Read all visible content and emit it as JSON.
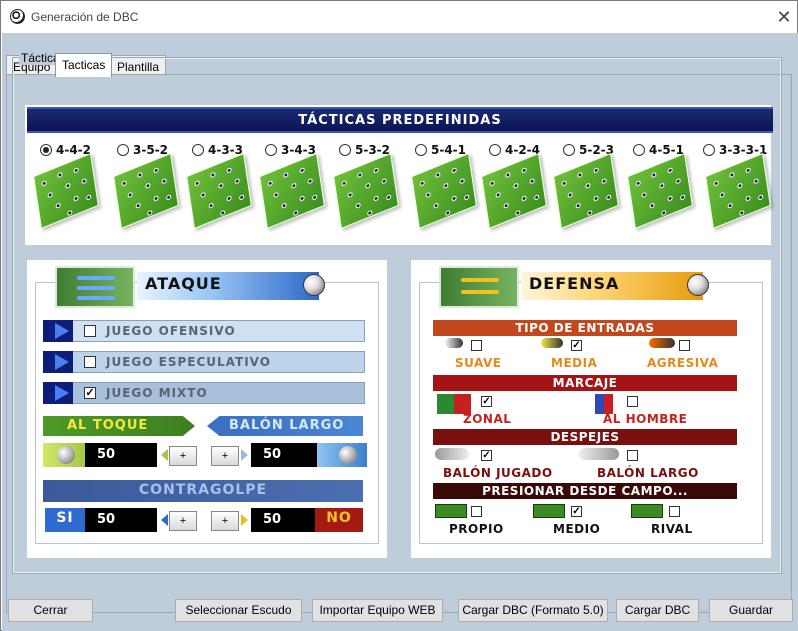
{
  "window": {
    "title": "Generación de DBC",
    "close_glyph": "✕"
  },
  "tabs": [
    {
      "label": "Equipo"
    },
    {
      "label": "Tacticas"
    },
    {
      "label": "Plantilla"
    }
  ],
  "group": {
    "label": "Táctica"
  },
  "predefinidas": {
    "title": "TÁCTICAS PREDEFINIDAS",
    "selected": "4-4-2",
    "formations": [
      "4-4-2",
      "3-5-2",
      "4-3-3",
      "3-4-3",
      "5-3-2",
      "5-4-1",
      "4-2-4",
      "5-2-3",
      "4-5-1",
      "3-3-3-1"
    ]
  },
  "ataque": {
    "title": "ATAQUE",
    "options": [
      {
        "label": "JUEGO OFENSIVO",
        "checked": false
      },
      {
        "label": "JUEGO ESPECULATIVO",
        "checked": false
      },
      {
        "label": "JUEGO MIXTO",
        "checked": true
      }
    ],
    "al_toque": "AL TOQUE",
    "balon_largo": "BALÓN LARGO",
    "al_toque_value": "50",
    "balon_largo_value": "50",
    "contragolpe": "CONTRAGOLPE",
    "si": "SI",
    "no": "NO",
    "si_value": "50",
    "no_value": "50",
    "plus": "+"
  },
  "defensa": {
    "title": "DEFENSA",
    "tipo_entradas": "TIPO DE ENTRADAS",
    "entradas": [
      {
        "label": "SUAVE",
        "checked": false
      },
      {
        "label": "MEDIA",
        "checked": true
      },
      {
        "label": "AGRESIVA",
        "checked": false
      }
    ],
    "marcaje": "MARCAJE",
    "marcajes": [
      {
        "label": "ZONAL",
        "checked": true
      },
      {
        "label": "AL HOMBRE",
        "checked": false
      }
    ],
    "despejes": "DESPEJES",
    "despeje_opts": [
      {
        "label": "BALÓN JUGADO",
        "checked": true
      },
      {
        "label": "BALÓN LARGO",
        "checked": false
      }
    ],
    "presionar": "PRESIONAR DESDE CAMPO...",
    "presion_opts": [
      {
        "label": "PROPIO",
        "checked": false
      },
      {
        "label": "MEDIO",
        "checked": true
      },
      {
        "label": "RIVAL",
        "checked": false
      }
    ]
  },
  "buttons": {
    "cerrar": "Cerrar",
    "escudo": "Seleccionar Escudo",
    "importar": "Importar Equipo WEB",
    "cargar50": "Cargar DBC (Formato 5.0)",
    "cargar": "Cargar DBC",
    "guardar": "Guardar"
  },
  "colors": {
    "header_blue": "#0b1552",
    "entradas_bar": "#c0481c",
    "marcaje_bar": "#a41414",
    "despejes_bar": "#7a0f0f",
    "presionar_bar": "#3b0808"
  }
}
